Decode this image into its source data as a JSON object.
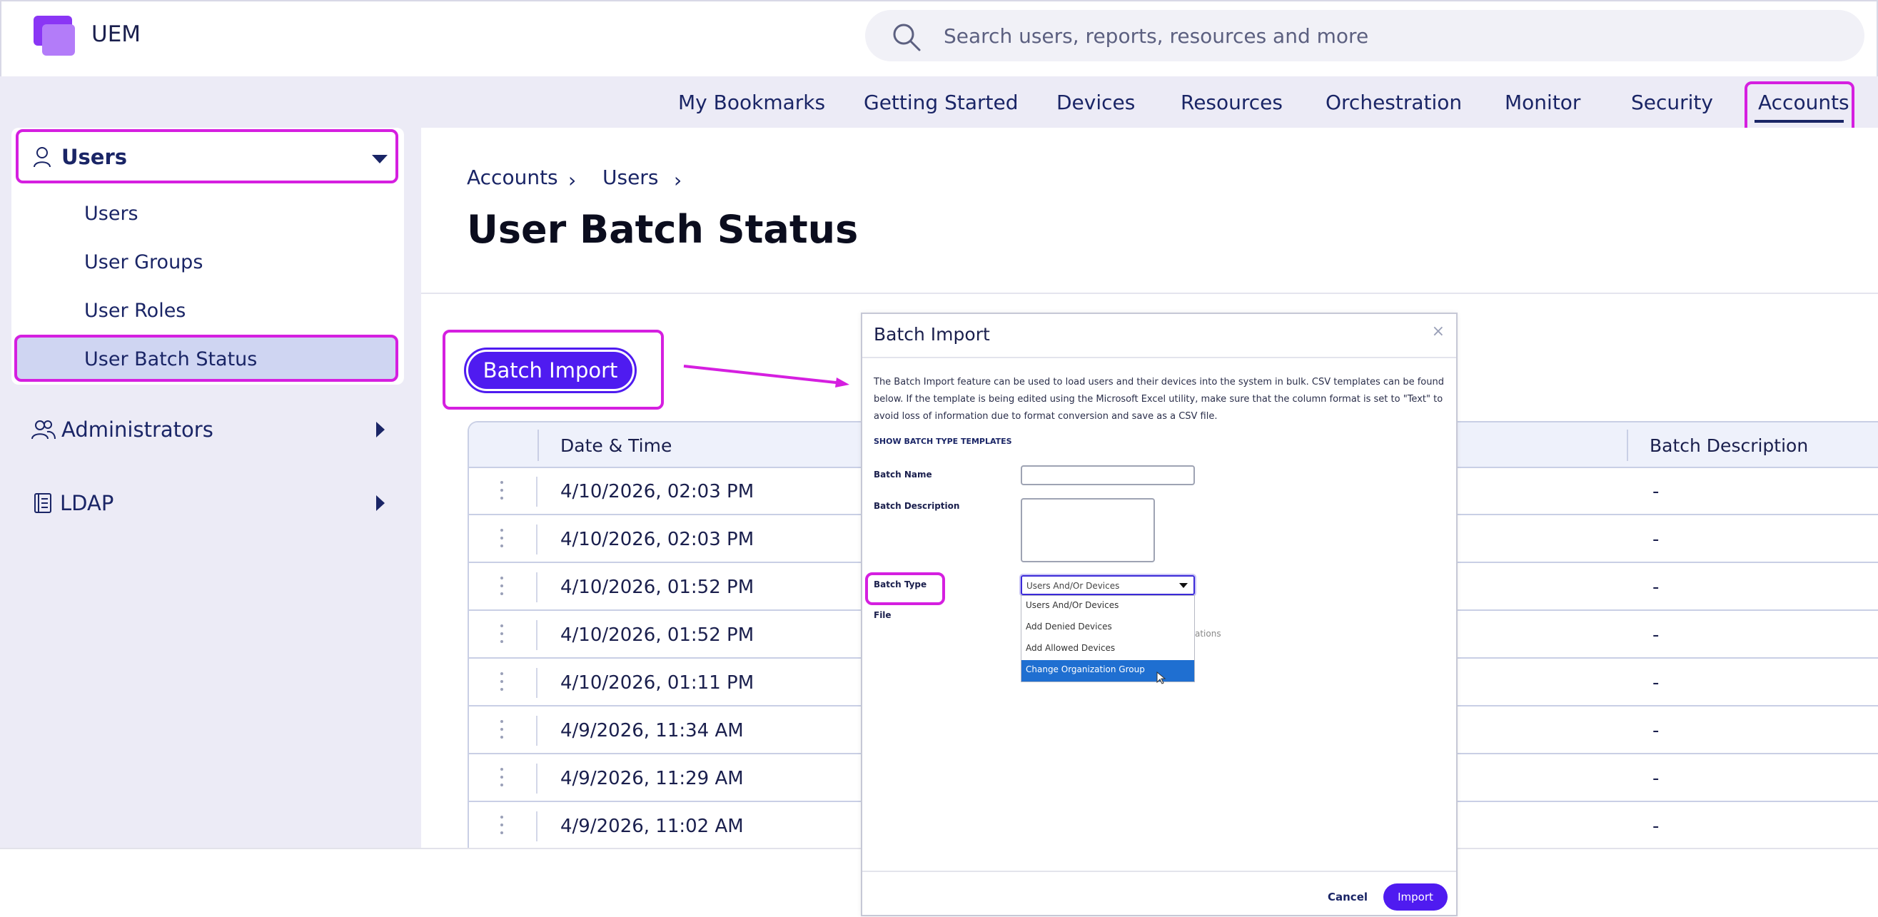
{
  "app": {
    "brand": "UEM"
  },
  "search": {
    "placeholder": "Search users, reports, resources and more"
  },
  "nav": {
    "items": [
      "My Bookmarks",
      "Getting Started",
      "Devices",
      "Resources",
      "Orchestration",
      "Monitor",
      "Security",
      "Accounts"
    ],
    "active": "Accounts"
  },
  "sidebar": {
    "users_group": "Users",
    "users_items": [
      "Users",
      "User Groups",
      "User Roles",
      "User Batch Status"
    ],
    "selected": "User Batch Status",
    "administrators": "Administrators",
    "ldap": "LDAP"
  },
  "breadcrumb": [
    "Accounts",
    "Users"
  ],
  "page": {
    "title": "User Batch Status"
  },
  "actions": {
    "batch_import": "Batch Import"
  },
  "table": {
    "headers": {
      "date_time": "Date & Time",
      "batch_description": "Batch Description"
    },
    "rows": [
      {
        "date": "4/10/2026, 02:03 PM",
        "desc": "-"
      },
      {
        "date": "4/10/2026, 02:03 PM",
        "desc": "-"
      },
      {
        "date": "4/10/2026, 01:52 PM",
        "desc": "-"
      },
      {
        "date": "4/10/2026, 01:52 PM",
        "desc": "-"
      },
      {
        "date": "4/10/2026, 01:11 PM",
        "desc": "-"
      },
      {
        "date": "4/9/2026, 11:34 AM",
        "desc": "-"
      },
      {
        "date": "4/9/2026, 11:29 AM",
        "desc": "-"
      },
      {
        "date": "4/9/2026, 11:02 AM",
        "desc": "-"
      }
    ]
  },
  "modal": {
    "title": "Batch Import",
    "close": "×",
    "info": "The Batch Import feature can be used to load users and their devices into the system in bulk. CSV templates can be found below. If the template is being edited using the Microsoft Excel utility, make sure that the column format is set to \"Text\" to avoid loss of information due to format conversion and save as a CSV file.",
    "show_templates": "SHOW BATCH TYPE TEMPLATES",
    "batch_name_label": "Batch Name",
    "batch_description_label": "Batch Description",
    "batch_type_label": "Batch Type",
    "file_label": "File",
    "batch_type_value": "Users And/Or Devices",
    "batch_type_options": [
      "Users And/Or Devices",
      "Add Denied Devices",
      "Add Allowed Devices",
      "Change Organization Group"
    ],
    "highlighted_option": "Change Organization Group",
    "faded_text": "ations",
    "cancel": "Cancel",
    "import": "Import"
  },
  "colors": {
    "accent": "#4f1bf0",
    "highlight": "#d51fe0",
    "selected_option": "#1f6fd1"
  }
}
